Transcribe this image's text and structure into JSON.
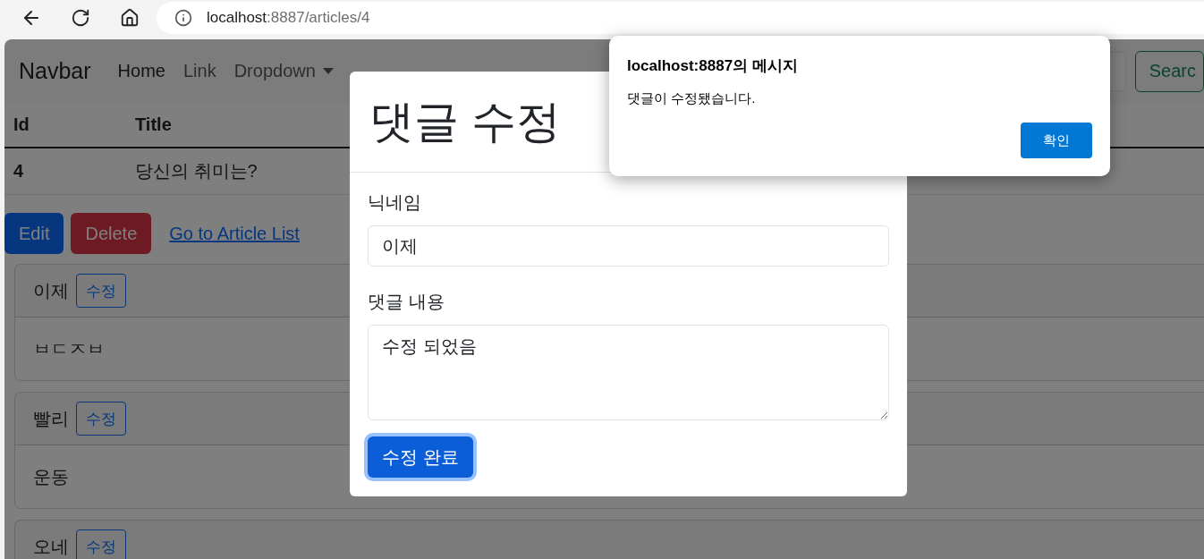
{
  "browser": {
    "url_host": "localhost",
    "url_path": ":8887/articles/4"
  },
  "navbar": {
    "brand": "Navbar",
    "links": [
      {
        "label": "Home",
        "kind": "link",
        "selected": true
      },
      {
        "label": "Link",
        "kind": "link",
        "selected": false
      },
      {
        "label": "Dropdown",
        "kind": "dropdown",
        "selected": false
      }
    ],
    "search_button": "Searc"
  },
  "article_table": {
    "columns": [
      "Id",
      "Title"
    ],
    "rows": [
      [
        "4",
        "당신의 취미는?"
      ]
    ]
  },
  "actions": {
    "edit": "Edit",
    "delete": "Delete",
    "list_link": "Go to Article List"
  },
  "comments": [
    {
      "nickname": "이제",
      "edit_button": "수정",
      "body": "ㅂㄷㅈㅂ"
    },
    {
      "nickname": "빨리",
      "edit_button": "수정",
      "body": "운동"
    },
    {
      "nickname": "오네",
      "edit_button": "수정"
    }
  ],
  "modal": {
    "title": "댓글 수정",
    "fields": [
      {
        "label": "닉네임",
        "value": "이제",
        "kind": "input"
      },
      {
        "label": "댓글 내용",
        "value": "수정 되었음",
        "kind": "textarea"
      }
    ],
    "submit": {
      "label": "수정 완료",
      "focused": true
    }
  },
  "alert": {
    "title": "localhost:8887의 메시지",
    "message": "댓글이 수정됐습니다.",
    "ok": "확인"
  }
}
